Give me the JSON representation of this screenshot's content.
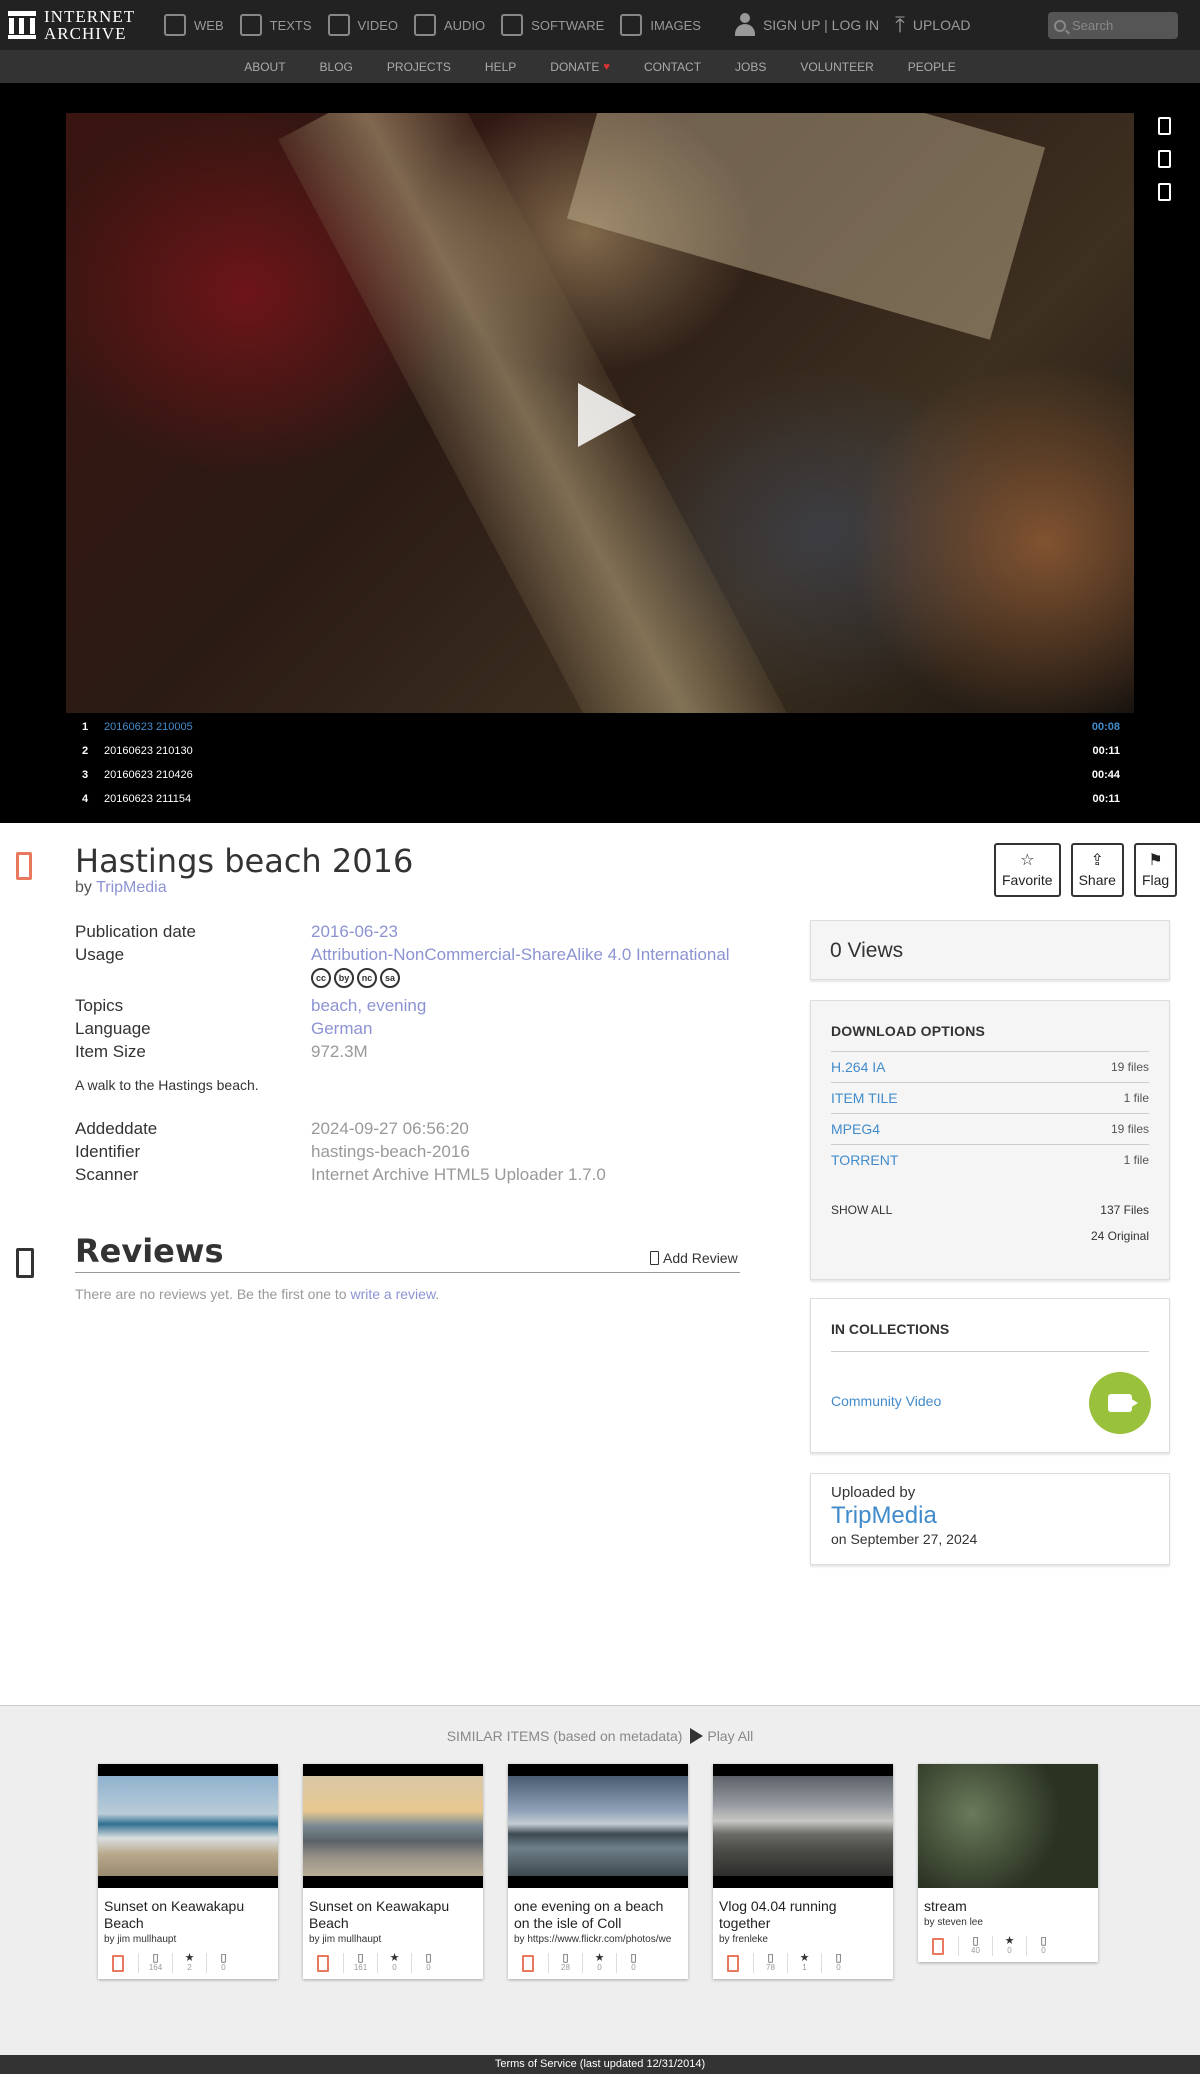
{
  "nav": {
    "logo_line1": "INTERNET",
    "logo_line2": "ARCHIVE",
    "mediatypes": [
      "WEB",
      "TEXTS",
      "VIDEO",
      "AUDIO",
      "SOFTWARE",
      "IMAGES"
    ],
    "signup": "SIGN UP | LOG IN",
    "upload": "UPLOAD",
    "search_placeholder": "Search"
  },
  "subnav": [
    "ABOUT",
    "BLOG",
    "PROJECTS",
    "HELP",
    "DONATE",
    "CONTACT",
    "JOBS",
    "VOLUNTEER",
    "PEOPLE"
  ],
  "playlist": [
    {
      "n": "1",
      "title": "20160623 210005",
      "dur": "00:08"
    },
    {
      "n": "2",
      "title": "20160623 210130",
      "dur": "00:11"
    },
    {
      "n": "3",
      "title": "20160623 210426",
      "dur": "00:44"
    },
    {
      "n": "4",
      "title": "20160623 211154",
      "dur": "00:11"
    }
  ],
  "item": {
    "title": "Hastings beach 2016",
    "by": "by",
    "author": "TripMedia",
    "actions": {
      "favorite": "Favorite",
      "share": "Share",
      "flag": "Flag"
    },
    "metadata": [
      {
        "k": "Publication date",
        "v": "2016-06-23",
        "link": true
      },
      {
        "k": "Usage",
        "v": "Attribution-NonCommercial-ShareAlike 4.0 International",
        "link": true
      },
      {
        "k": "Topics",
        "v": "beach, evening",
        "link": true
      },
      {
        "k": "Language",
        "v": "German",
        "link": true
      },
      {
        "k": "Item Size",
        "v": "972.3M",
        "link": false
      }
    ],
    "cc_icons": [
      "cc",
      "by",
      "nc",
      "sa"
    ],
    "description": "A walk to the Hastings beach.",
    "metadata2": [
      {
        "k": "Addeddate",
        "v": "2024-09-27 06:56:20"
      },
      {
        "k": "Identifier",
        "v": "hastings-beach-2016"
      },
      {
        "k": "Scanner",
        "v": "Internet Archive HTML5 Uploader 1.7.0"
      }
    ]
  },
  "reviews": {
    "heading": "Reviews",
    "add": "Add Review",
    "empty_text": "There are no reviews yet. Be the first one to",
    "write_link": "write a review",
    "period": "."
  },
  "sidebar": {
    "views": "0 Views",
    "download_heading": "DOWNLOAD OPTIONS",
    "downloads": [
      {
        "format": "H.264 IA",
        "count": "19 files"
      },
      {
        "format": "ITEM TILE",
        "count": "1 file"
      },
      {
        "format": "MPEG4",
        "count": "19 files"
      },
      {
        "format": "TORRENT",
        "count": "1 file"
      }
    ],
    "show_all": "SHOW ALL",
    "total_files": "137 Files",
    "original": "24 Original",
    "collections_heading": "IN COLLECTIONS",
    "collection": "Community Video",
    "uploaded_by_label": "Uploaded by",
    "uploader": "TripMedia",
    "uploaded_on": "on September 27, 2024"
  },
  "similar": {
    "heading": "SIMILAR ITEMS (based on metadata)",
    "play_all": "Play All",
    "items": [
      {
        "title": "Sunset on Keawakapu Beach",
        "by": "by jim mullhaupt",
        "views": "164",
        "favs": "2",
        "reviews": "0"
      },
      {
        "title": "Sunset on Keawakapu Beach",
        "by": "by jim mullhaupt",
        "views": "161",
        "favs": "0",
        "reviews": "0"
      },
      {
        "title": "one evening on a beach on the isle of Coll",
        "by": "by https://www.flickr.com/photos/we",
        "views": "28",
        "favs": "0",
        "reviews": "0"
      },
      {
        "title": "Vlog 04.04 running together",
        "by": "by frenleke",
        "views": "78",
        "favs": "1",
        "reviews": "0"
      },
      {
        "title": "stream",
        "by": "by steven lee",
        "views": "40",
        "favs": "0",
        "reviews": "0"
      }
    ]
  },
  "footer": "Terms of Service (last updated 12/31/2014)"
}
